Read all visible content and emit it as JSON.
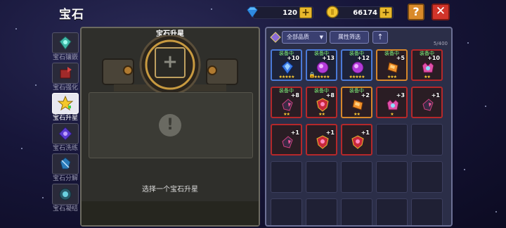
{
  "title": "宝石",
  "currency": {
    "diamond": {
      "value": "120",
      "icon": "diamond-icon"
    },
    "gold": {
      "value": "66174",
      "icon": "gold-coin-icon"
    },
    "add_label": "+"
  },
  "buttons": {
    "help": "?",
    "close": "✕"
  },
  "nav": [
    {
      "label": "宝石镶嵌",
      "icon": "gem-inlay-icon"
    },
    {
      "label": "宝石强化",
      "icon": "gem-enhance-icon"
    },
    {
      "label": "宝石升星",
      "icon": "gem-star-icon"
    },
    {
      "label": "宝石洗练",
      "icon": "gem-refine-icon"
    },
    {
      "label": "宝石分解",
      "icon": "gem-decompose-icon"
    },
    {
      "label": "宝石凝结",
      "icon": "gem-condense-icon"
    }
  ],
  "left_panel": {
    "header": "宝石升星",
    "slot_plus": "+",
    "warning": "!",
    "hint": "选择一个宝石升星"
  },
  "right_panel": {
    "quality_filter": "全部品质",
    "attr_filter": "属性筛选",
    "sort_icon": "↑",
    "capacity": "5/400",
    "items": [
      {
        "equipped": "装备中",
        "level": "+10",
        "stars": "★★★★★",
        "rarity": "blue",
        "gem": "blue-diamond",
        "locked": false
      },
      {
        "equipped": "装备中",
        "level": "+13",
        "stars": "★★★★★",
        "rarity": "blue",
        "gem": "purple-orb",
        "locked": true
      },
      {
        "equipped": "装备中",
        "level": "+12",
        "stars": "★★★★★",
        "rarity": "blue",
        "gem": "purple-orb",
        "locked": false
      },
      {
        "equipped": "装备中",
        "level": "+5",
        "stars": "★★★",
        "rarity": "orange",
        "gem": "orange-shard",
        "locked": false
      },
      {
        "equipped": "装备中",
        "level": "+10",
        "stars": "★★",
        "rarity": "red",
        "gem": "pink-crown",
        "locked": false
      },
      {
        "equipped": "装备中",
        "level": "+8",
        "stars": "★★",
        "rarity": "red",
        "gem": "dark-crystal",
        "locked": false
      },
      {
        "equipped": "装备中",
        "level": "+8",
        "stars": "★★",
        "rarity": "red",
        "gem": "red-shield",
        "locked": false
      },
      {
        "equipped": "装备中",
        "level": "+2",
        "stars": "★★",
        "rarity": "orange",
        "gem": "orange-shard",
        "locked": false
      },
      {
        "equipped": "",
        "level": "+3",
        "stars": "★",
        "rarity": "red",
        "gem": "pink-crown",
        "locked": false
      },
      {
        "equipped": "",
        "level": "+1",
        "stars": "",
        "rarity": "red",
        "gem": "dark-crystal",
        "locked": false
      },
      {
        "equipped": "",
        "level": "+1",
        "stars": "",
        "rarity": "red",
        "gem": "dark-crystal",
        "locked": false
      },
      {
        "equipped": "",
        "level": "+1",
        "stars": "",
        "rarity": "red",
        "gem": "red-shield",
        "locked": false
      },
      {
        "equipped": "",
        "level": "+1",
        "stars": "",
        "rarity": "red",
        "gem": "red-shield",
        "locked": false
      }
    ]
  },
  "colors": {
    "accent": "#e8b82c",
    "close": "#d0342a",
    "help": "#d98a2a",
    "equipped": "#7ef07a"
  }
}
